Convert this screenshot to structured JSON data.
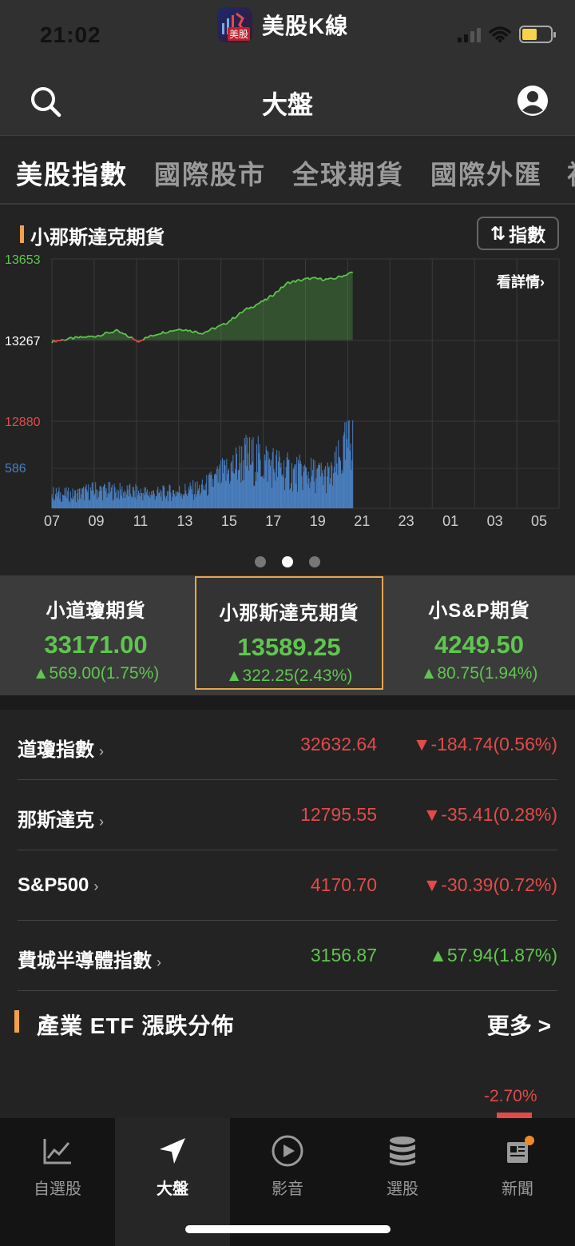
{
  "status_bar": {
    "time": "21:02",
    "app_name": "美股K線",
    "app_logo_label": "美股"
  },
  "nav": {
    "title": "大盤"
  },
  "tabs": [
    "美股指數",
    "國際股市",
    "全球期貨",
    "國際外匯",
    "初"
  ],
  "chart": {
    "title": "小那斯達克期貨",
    "toggle_label": "指數",
    "detail_link": "看詳情",
    "y_labels": {
      "high": "13653",
      "mid": "13267",
      "low": "12880",
      "volume": "586"
    },
    "x_labels": [
      "07",
      "09",
      "11",
      "13",
      "15",
      "17",
      "19",
      "21",
      "23",
      "01",
      "03",
      "05"
    ]
  },
  "chart_data": {
    "type": "line",
    "title": "小那斯達克期貨",
    "x_ticks": [
      "07",
      "09",
      "11",
      "13",
      "15",
      "17",
      "19",
      "21",
      "23",
      "01",
      "03",
      "05"
    ],
    "ylim": [
      12880,
      13653
    ],
    "reference": 13267,
    "volume_max": 586,
    "series": [
      {
        "name": "price",
        "x": [
          "07",
          "08",
          "09",
          "10",
          "11",
          "12",
          "13",
          "14",
          "15",
          "16",
          "17",
          "18",
          "19",
          "20",
          "21"
        ],
        "values": [
          13260,
          13275,
          13285,
          13310,
          13262,
          13300,
          13320,
          13300,
          13340,
          13410,
          13460,
          13540,
          13560,
          13555,
          13589
        ]
      },
      {
        "name": "volume",
        "x": [
          "07",
          "08",
          "09",
          "10",
          "11",
          "12",
          "13",
          "14",
          "15",
          "16",
          "17",
          "18",
          "19",
          "20",
          "21"
        ],
        "values": [
          120,
          110,
          150,
          140,
          130,
          120,
          140,
          160,
          280,
          410,
          380,
          300,
          280,
          260,
          586
        ]
      }
    ]
  },
  "pager": {
    "count": 3,
    "active": 1
  },
  "futures": [
    {
      "name": "小道瓊期貨",
      "price": "33171.00",
      "change": "▲569.00(1.75%)"
    },
    {
      "name": "小那斯達克期貨",
      "price": "13589.25",
      "change": "▲322.25(2.43%)"
    },
    {
      "name": "小S&P期貨",
      "price": "4249.50",
      "change": "▲80.75(1.94%)"
    }
  ],
  "indices": [
    {
      "name": "道瓊指數",
      "value": "32632.64",
      "change": "▼-184.74(0.56%)",
      "direction": "down"
    },
    {
      "name": "那斯達克",
      "value": "12795.55",
      "change": "▼-35.41(0.28%)",
      "direction": "down"
    },
    {
      "name": "S&P500",
      "value": "4170.70",
      "change": "▼-30.39(0.72%)",
      "direction": "down"
    },
    {
      "name": "費城半導體指數",
      "value": "3156.87",
      "change": "▲57.94(1.87%)",
      "direction": "up"
    }
  ],
  "etf": {
    "title": "產業 ETF 漲跌分佈",
    "more": "更多 >",
    "visible_value": "-2.70%"
  },
  "bottom_nav": [
    "自選股",
    "大盤",
    "影音",
    "選股",
    "新聞"
  ],
  "colors": {
    "up": "#5fc64f",
    "down": "#e34a4a",
    "accent": "#f0a34a",
    "volume": "#4a7fc0"
  }
}
